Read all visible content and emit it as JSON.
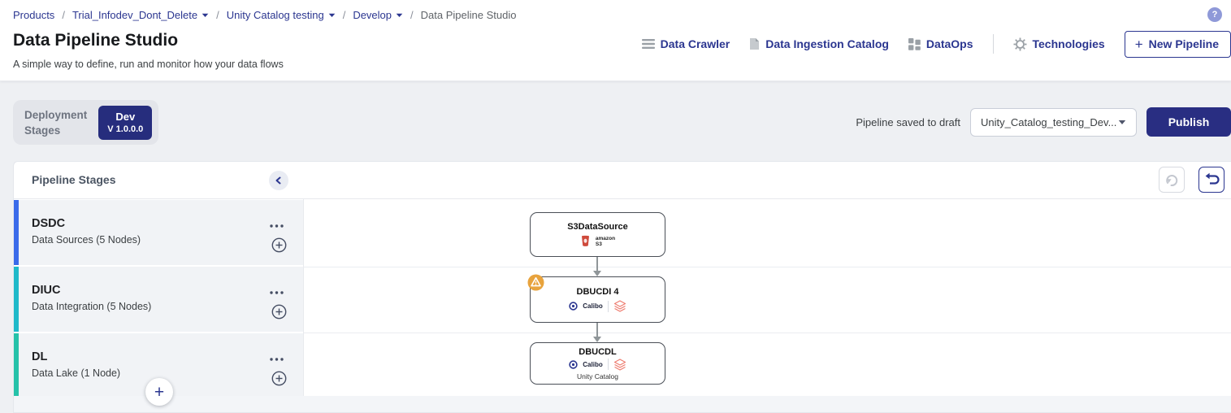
{
  "breadcrumb": {
    "separator": "/",
    "items": [
      {
        "label": "Products"
      },
      {
        "label": "Trial_Infodev_Dont_Delete"
      },
      {
        "label": "Unity Catalog testing"
      },
      {
        "label": "Develop"
      },
      {
        "label": "Data Pipeline Studio"
      }
    ]
  },
  "header": {
    "title": "Data Pipeline Studio",
    "subtitle": "A simple way to define, run and monitor how your data flows",
    "help_glyph": "?",
    "nav": {
      "data_crawler": "Data Crawler",
      "data_ingestion_catalog": "Data Ingestion Catalog",
      "dataops": "DataOps",
      "technologies": "Technologies",
      "new_pipeline": "New Pipeline",
      "new_pipeline_plus": "+"
    }
  },
  "toolbar": {
    "deployment_label_line1": "Deployment",
    "deployment_label_line2": "Stages",
    "environment": "Dev",
    "version": "V 1.0.0.0",
    "saved_status": "Pipeline saved to draft",
    "pipeline_dropdown_value": "Unity_Catalog_testing_Dev...",
    "publish_label": "Publish"
  },
  "pipeline_panel": {
    "title": "Pipeline Stages",
    "add_stage_plus": "+",
    "stages": [
      {
        "code": "DSDC",
        "description": "Data Sources (5 Nodes)",
        "accent_color": "#3a6bea"
      },
      {
        "code": "DIUC",
        "description": "Data Integration (5 Nodes)",
        "accent_color": "#1fb9c9"
      },
      {
        "code": "DL",
        "description": "Data Lake (1 Node)",
        "accent_color": "#25c2a9"
      }
    ]
  },
  "canvas": {
    "nodes": [
      {
        "title": "S3DataSource",
        "technology": "Amazon S3",
        "logo_line1": "amazon",
        "logo_line2": "S3"
      },
      {
        "title": "DBUCDI 4",
        "technology": "Calibo + Databricks",
        "logo_text": "Calibo",
        "warning": true
      },
      {
        "title": "DBUCDL",
        "technology": "Calibo + Databricks",
        "logo_text": "Calibo",
        "caption": "Unity Catalog"
      }
    ]
  },
  "colors": {
    "brand_navy": "#2b3690",
    "button_navy": "#292e82",
    "badge_navy": "#262d7d",
    "page_bg": "#eef0f3",
    "stage_row_bg": "#f1f3f6",
    "warning_amber": "#e8a33d",
    "s3_red": "#cf4a3c",
    "databricks_salmon": "#ee7b6e"
  }
}
